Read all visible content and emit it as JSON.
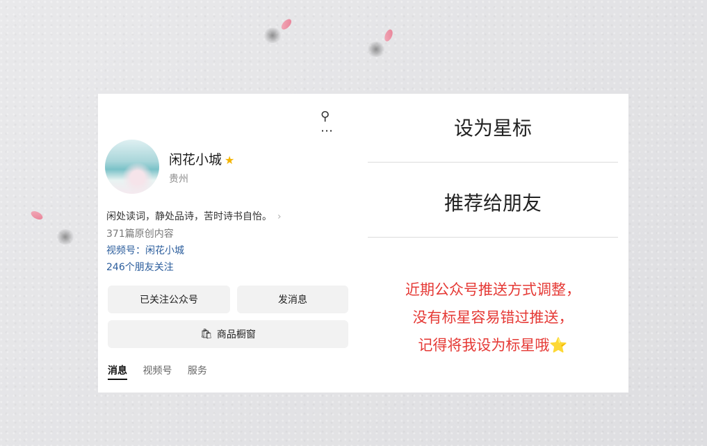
{
  "profile": {
    "name": "闲花小城",
    "region": "贵州",
    "bio": "闲处读词，静处品诗，苦时诗书自怡。",
    "original_count": "371篇原创内容",
    "channel": "视频号：闲花小城",
    "friends_follow": "246个朋友关注",
    "buttons": {
      "follow": "已关注公众号",
      "message": "发消息",
      "shop": "商品橱窗"
    },
    "tabs": [
      "消息",
      "视频号",
      "服务"
    ]
  },
  "menu": {
    "star": "设为星标",
    "recommend": "推荐给朋友"
  },
  "notice": {
    "line1": "近期公众号推送方式调整，",
    "line2": "没有标星容易错过推送，",
    "line3": "记得将我设为标星哦"
  },
  "icons": {
    "search": "search-icon",
    "more": "more-icon",
    "verified_star": "star-icon",
    "shop": "shop-icon"
  },
  "colors": {
    "notice_red": "#e53935",
    "link_blue": "#2b5d9c",
    "star_gold": "#f4b400"
  }
}
